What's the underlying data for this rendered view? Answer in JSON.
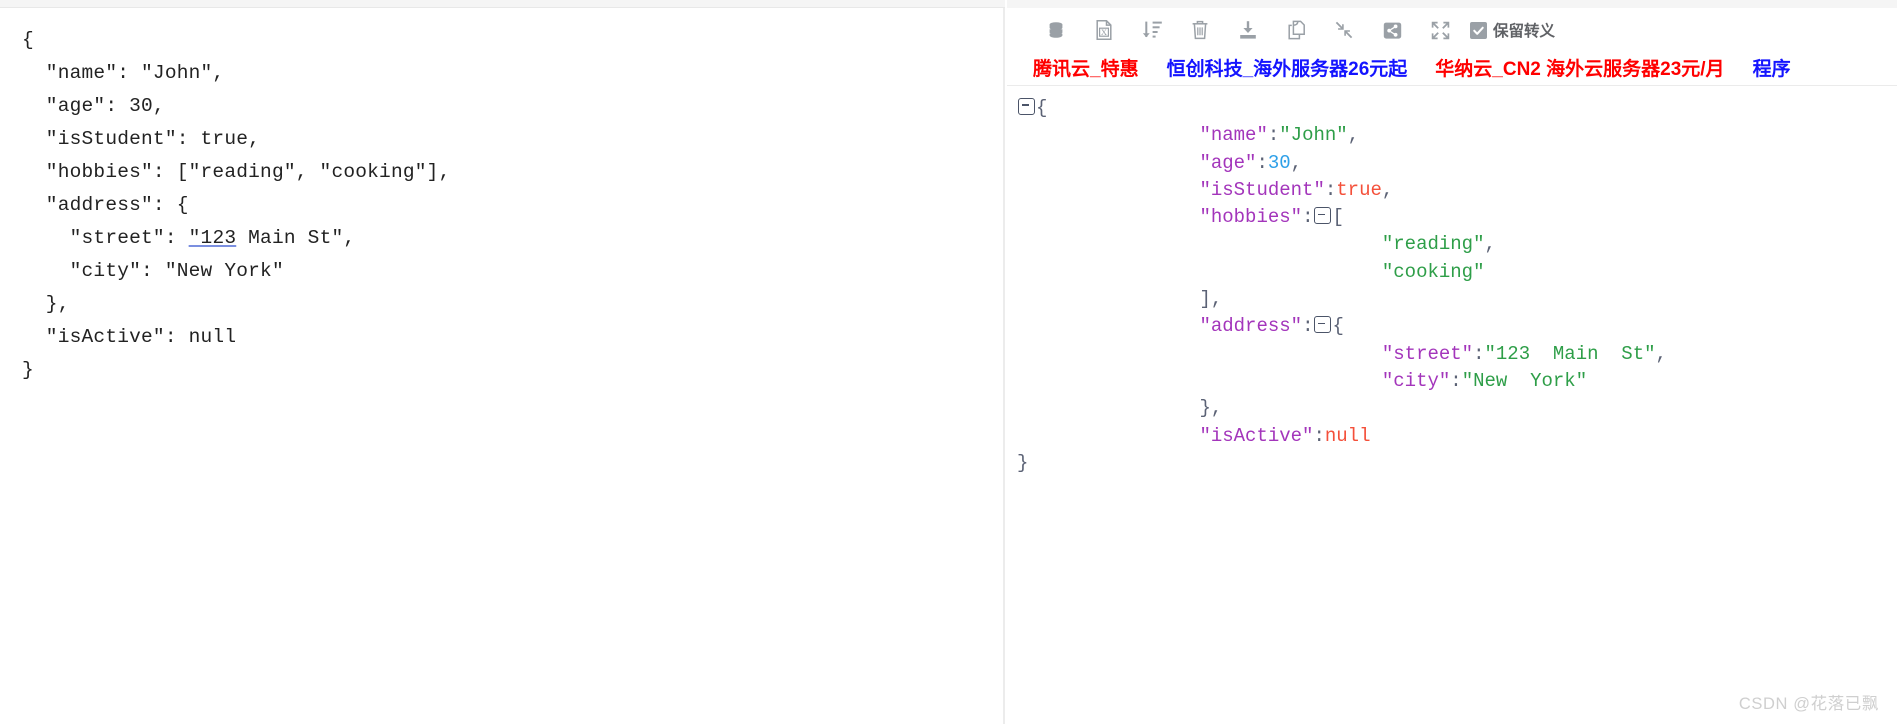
{
  "left_editor": {
    "name": "json-input-editor",
    "lines": [
      "{",
      "  \"name\": \"John\",",
      "  \"age\": 30,",
      "  \"isStudent\": true,",
      "  \"hobbies\": [\"reading\", \"cooking\"],",
      "  \"address\": {",
      "    \"street\": \"123 Main St\",",
      "    \"city\": \"New York\"",
      "  },",
      "  \"isActive\": null",
      "}"
    ],
    "misspelled_token": "\"123"
  },
  "toolbar": {
    "buttons": [
      {
        "icon": "database-icon",
        "label": "数据库"
      },
      {
        "icon": "excel-file-icon",
        "label": "导出Excel"
      },
      {
        "icon": "sort-ascending-icon",
        "label": "排序"
      },
      {
        "icon": "trash-icon",
        "label": "清空"
      },
      {
        "icon": "download-icon",
        "label": "下载"
      },
      {
        "icon": "copy-icon",
        "label": "复制"
      },
      {
        "icon": "compress-icon",
        "label": "压缩"
      },
      {
        "icon": "share-icon",
        "label": "分享"
      },
      {
        "icon": "expand-icon",
        "label": "全屏"
      }
    ],
    "keep_escape": {
      "label": "保留转义",
      "checked": true,
      "icon": "checkbox-checked-icon"
    }
  },
  "ad_bar": {
    "links": [
      {
        "text": "腾讯云_特惠",
        "color": "#ff0000"
      },
      {
        "text": "恒创科技_海外服务器26元起",
        "color": "#1414ff"
      },
      {
        "text": "华纳云_CN2 海外云服务器23元/月",
        "color": "#ff0000"
      },
      {
        "text": "程序",
        "color": "#1414ff"
      }
    ]
  },
  "json_output": {
    "lines": [
      {
        "indent": 0,
        "fold": true,
        "tokens": [
          {
            "t": "{",
            "c": "jpunc"
          }
        ]
      },
      {
        "indent": 4,
        "fold": false,
        "tokens": [
          {
            "t": "\"name\"",
            "c": "jkey"
          },
          {
            "t": ":",
            "c": "jpunc"
          },
          {
            "t": "\"John\"",
            "c": "jstr"
          },
          {
            "t": ",",
            "c": "jpunc"
          }
        ]
      },
      {
        "indent": 4,
        "fold": false,
        "tokens": [
          {
            "t": "\"age\"",
            "c": "jkey"
          },
          {
            "t": ":",
            "c": "jpunc"
          },
          {
            "t": "30",
            "c": "jnum"
          },
          {
            "t": ",",
            "c": "jpunc"
          }
        ]
      },
      {
        "indent": 4,
        "fold": false,
        "tokens": [
          {
            "t": "\"isStudent\"",
            "c": "jkey"
          },
          {
            "t": ":",
            "c": "jpunc"
          },
          {
            "t": "true",
            "c": "jlit"
          },
          {
            "t": ",",
            "c": "jpunc"
          }
        ]
      },
      {
        "indent": 4,
        "fold": true,
        "tokens": [
          {
            "t": "\"hobbies\"",
            "c": "jkey"
          },
          {
            "t": ":",
            "c": "jpunc"
          }
        ],
        "after_fold": [
          {
            "t": "[",
            "c": "jpunc"
          }
        ]
      },
      {
        "indent": 8,
        "fold": false,
        "tokens": [
          {
            "t": "\"reading\"",
            "c": "jstr"
          },
          {
            "t": ",",
            "c": "jpunc"
          }
        ]
      },
      {
        "indent": 8,
        "fold": false,
        "tokens": [
          {
            "t": "\"cooking\"",
            "c": "jstr"
          }
        ]
      },
      {
        "indent": 4,
        "fold": false,
        "tokens": [
          {
            "t": "],",
            "c": "jpunc"
          }
        ]
      },
      {
        "indent": 4,
        "fold": true,
        "tokens": [
          {
            "t": "\"address\"",
            "c": "jkey"
          },
          {
            "t": ":",
            "c": "jpunc"
          }
        ],
        "after_fold": [
          {
            "t": "{",
            "c": "jpunc"
          }
        ]
      },
      {
        "indent": 8,
        "fold": false,
        "tokens": [
          {
            "t": "\"street\"",
            "c": "jkey"
          },
          {
            "t": ":",
            "c": "jpunc"
          },
          {
            "t": "\"123  Main  St\"",
            "c": "jstr"
          },
          {
            "t": ",",
            "c": "jpunc"
          }
        ]
      },
      {
        "indent": 8,
        "fold": false,
        "tokens": [
          {
            "t": "\"city\"",
            "c": "jkey"
          },
          {
            "t": ":",
            "c": "jpunc"
          },
          {
            "t": "\"New  York\"",
            "c": "jstr"
          }
        ]
      },
      {
        "indent": 4,
        "fold": false,
        "tokens": [
          {
            "t": "},",
            "c": "jpunc"
          }
        ]
      },
      {
        "indent": 4,
        "fold": false,
        "tokens": [
          {
            "t": "\"isActive\"",
            "c": "jkey"
          },
          {
            "t": ":",
            "c": "jpunc"
          },
          {
            "t": "null",
            "c": "jlit"
          }
        ]
      },
      {
        "indent": 0,
        "fold": false,
        "tokens": [
          {
            "t": "}",
            "c": "jpunc"
          }
        ]
      }
    ]
  },
  "watermark": {
    "text": "CSDN @花落已飘"
  },
  "colors": {
    "key": "#a335bb",
    "string": "#2e9e48",
    "number": "#2fa0e8",
    "literal": "#f4503a",
    "punctuation": "#5b6275",
    "icon_gray": "#9aa0a6",
    "ad_red": "#ff0000",
    "ad_blue": "#1414ff"
  }
}
